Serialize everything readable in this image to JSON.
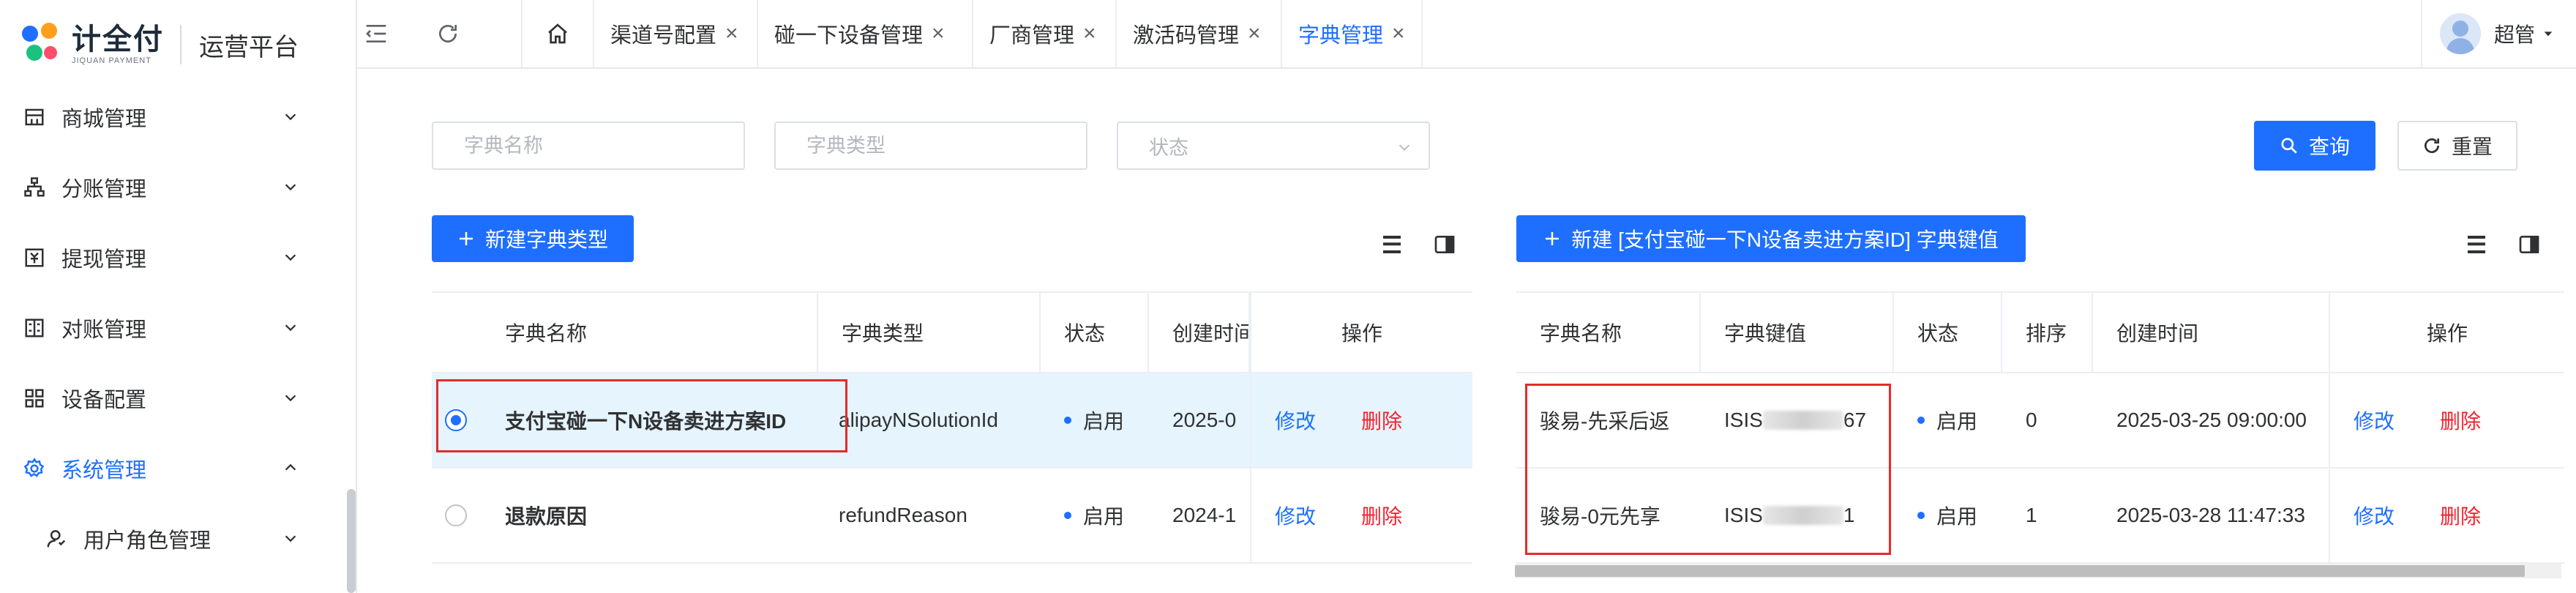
{
  "logo": {
    "name": "计全付",
    "sub": "JIQUAN PAYMENT",
    "platform": "运营平台"
  },
  "sidebar": {
    "items": [
      {
        "label": "商城管理",
        "icon": "shop-icon"
      },
      {
        "label": "分账管理",
        "icon": "org-chart-icon"
      },
      {
        "label": "提现管理",
        "icon": "withdraw-icon"
      },
      {
        "label": "对账管理",
        "icon": "reconcile-icon"
      },
      {
        "label": "设备配置",
        "icon": "grid-icon"
      },
      {
        "label": "系统管理",
        "icon": "gear-icon",
        "active": true,
        "expanded": true
      },
      {
        "label": "用户角色管理",
        "icon": "user-icon",
        "sub": true
      }
    ]
  },
  "tabs": [
    {
      "label": "渠道号配置"
    },
    {
      "label": "碰一下设备管理"
    },
    {
      "label": "厂商管理"
    },
    {
      "label": "激活码管理"
    },
    {
      "label": "字典管理",
      "active": true
    }
  ],
  "user": {
    "name": "超管"
  },
  "filters": {
    "dict_name_placeholder": "字典名称",
    "dict_type_placeholder": "字典类型",
    "status_placeholder": "状态",
    "query_label": "查询",
    "reset_label": "重置"
  },
  "left": {
    "add_label": "新建字典类型",
    "columns": [
      "字典名称",
      "字典类型",
      "状态",
      "创建时间",
      "操作"
    ],
    "rows": [
      {
        "name": "支付宝碰一下N设备卖进方案ID",
        "type": "alipayNSolutionId",
        "status": "启用",
        "created": "2025-0",
        "edit": "修改",
        "delete": "删除",
        "selected": true
      },
      {
        "name": "退款原因",
        "type": "refundReason",
        "status": "启用",
        "created": "2024-1",
        "edit": "修改",
        "delete": "删除",
        "selected": false
      }
    ]
  },
  "right": {
    "add_label": "新建 [支付宝碰一下N设备卖进方案ID] 字典键值",
    "columns": [
      "字典名称",
      "字典键值",
      "状态",
      "排序",
      "创建时间",
      "操作"
    ],
    "rows": [
      {
        "name": "骏易-先采后返",
        "key_prefix": "ISIS",
        "key_suffix": "67",
        "status": "启用",
        "sort": "0",
        "created": "2025-03-25 09:00:00",
        "edit": "修改",
        "delete": "删除"
      },
      {
        "name": "骏易-0元先享",
        "key_prefix": "ISIS",
        "key_suffix": "1",
        "status": "启用",
        "sort": "1",
        "created": "2025-03-28 11:47:33",
        "edit": "修改",
        "delete": "删除"
      }
    ]
  },
  "colors": {
    "primary": "#1e6fff",
    "danger": "#f5222d",
    "selected_row": "#e5f4fd",
    "highlight_box": "#e32b2b"
  }
}
